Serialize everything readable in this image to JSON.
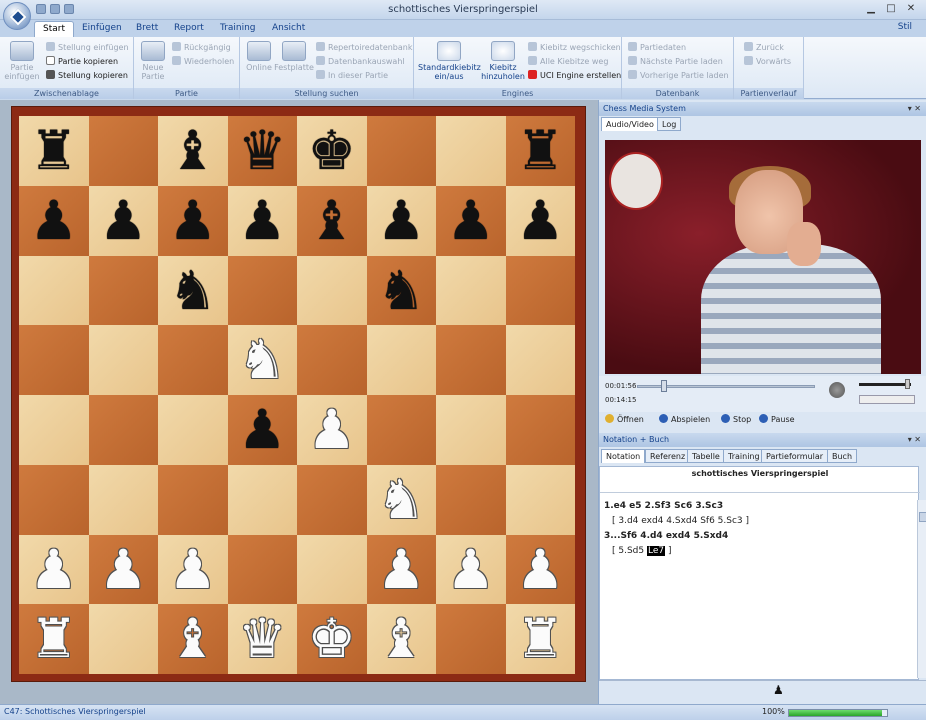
{
  "window": {
    "title": "schottisches Vierspringerspiel"
  },
  "tabs": [
    "Start",
    "Einfügen",
    "Brett",
    "Report",
    "Training",
    "Ansicht"
  ],
  "stil": "Stil",
  "ribbon": {
    "zwischenablage": {
      "label": "Zwischenablage",
      "big": "Partie\neinfügen",
      "items": [
        "Stellung einfügen",
        "Partie kopieren",
        "Stellung kopieren"
      ]
    },
    "partie": {
      "label": "Partie",
      "big": "Neue\nPartie",
      "items": [
        "Rückgängig",
        "Wiederholen"
      ]
    },
    "stellung": {
      "label": "Stellung suchen",
      "big1": "Online",
      "big2": "Festplatte",
      "items": [
        "Repertoiredatenbank",
        "Datenbankauswahl",
        "In dieser Partie"
      ]
    },
    "engines": {
      "label": "Engines",
      "big1": "Standardkiebitz\nein/aus",
      "big2": "Kiebitz\nhinzuholen",
      "items": [
        "Kiebitz wegschicken",
        "Alle Kiebitze weg",
        "UCI Engine erstellen"
      ]
    },
    "datenbank": {
      "label": "Datenbank",
      "items": [
        "Partiedaten",
        "Nächste Partie laden",
        "Vorherige Partie laden"
      ]
    },
    "partienverlauf": {
      "label": "Partienverlauf",
      "items": [
        "Zurück",
        "Vorwärts"
      ]
    }
  },
  "board": {
    "rows": [
      [
        "br",
        "",
        "bb",
        "bq",
        "bk",
        "",
        "",
        "br"
      ],
      [
        "bp",
        "bp",
        "bp",
        "bp",
        "bb",
        "bp",
        "bp",
        "bp"
      ],
      [
        "",
        "",
        "bn",
        "",
        "",
        "bn",
        "",
        ""
      ],
      [
        "",
        "",
        "",
        "wn",
        "",
        "",
        "",
        ""
      ],
      [
        "",
        "",
        "",
        "bp",
        "wp",
        "",
        "",
        ""
      ],
      [
        "",
        "",
        "",
        "",
        "",
        "wn",
        "",
        ""
      ],
      [
        "wp",
        "wp",
        "wp",
        "",
        "",
        "wp",
        "wp",
        "wp"
      ],
      [
        "wr",
        "",
        "wb",
        "wq",
        "wk",
        "wb",
        "",
        "wr"
      ]
    ]
  },
  "media": {
    "header": "Chess Media System",
    "tabs": [
      "Audio/Video",
      "Log"
    ],
    "time_current": "00:01:56",
    "time_total": "00:14:15",
    "buttons": [
      "Öffnen",
      "Abspielen",
      "Stop",
      "Pause"
    ]
  },
  "notation": {
    "header": "Notation + Buch",
    "tabs": [
      "Notation",
      "Referenz",
      "Tabelle",
      "Training",
      "Partieformular",
      "Buch"
    ],
    "game_title": "schottisches Vierspringerspiel",
    "line1": "1.e4  e5  2.Sf3  Sc6  3.Sc3",
    "line2": "[ 3.d4  exd4  4.Sxd4  Sf6  5.Sc3 ]",
    "line3": "3...Sf6  4.d4  exd4  5.Sxd4",
    "line4_pre": "[ 5.Sd5 ",
    "line4_hl": "Le7",
    "line4_post": " ]"
  },
  "status": {
    "text": "C47: Schottisches Vierspringerspiel",
    "zoom": "100%",
    "zoom_fraction": 0.95
  }
}
